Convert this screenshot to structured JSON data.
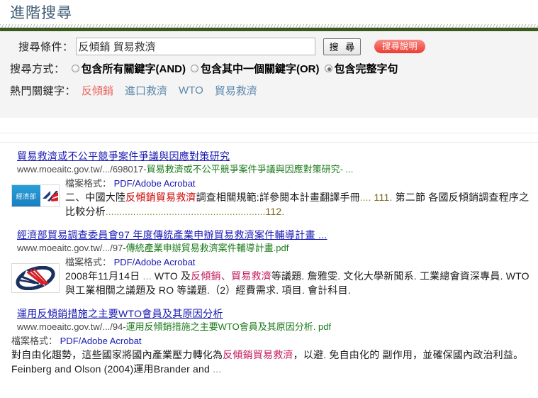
{
  "header": {
    "title": "進階搜尋",
    "accent_green": "#3a5a1e",
    "title_color": "#3d5a73"
  },
  "search": {
    "condition_label": "搜尋條件：",
    "input_value": "反傾銷 貿易救濟",
    "input_placeholder": "",
    "submit_label": "搜 尋",
    "help_label": "搜尋說明",
    "help_color": "#ed3b32",
    "mode_label": "搜尋方式：",
    "modes": [
      {
        "label": "包含所有關鍵字(AND)",
        "checked": false
      },
      {
        "label": "包含其中一個關鍵字(OR)",
        "checked": false
      },
      {
        "label": "包含完整字句",
        "checked": true
      }
    ],
    "hot_label": "熱門關鍵字：",
    "hot_keywords": [
      {
        "text": "反傾銷",
        "color": "#e8635c"
      },
      {
        "text": "進口救濟",
        "color": "#5b87ab"
      },
      {
        "text": "WTO",
        "color": "#5b87ab"
      },
      {
        "text": "貿易救濟",
        "color": "#5b87ab"
      }
    ]
  },
  "results": [
    {
      "title": "貿易救濟或不公平競爭案件爭議與因應對策研究",
      "url_host": "www.moeaitc.gov.tw/.../698017-",
      "url_tail": "貿易救濟或不公平競爭案件爭議與因應對策研究- ...",
      "format_label": "檔案格式：",
      "format_value": "PDF/Adobe Acrobat",
      "thumbnail": "moea-logo",
      "snippet_parts": [
        {
          "t": "二、中國大陸",
          "s": "plain"
        },
        {
          "t": "反傾銷貿易救濟",
          "s": "hl-red"
        },
        {
          "t": "調查相關規範:詳參閱本計畫翻譯手冊",
          "s": "plain"
        },
        {
          "t": "....",
          "s": "dots"
        },
        {
          "t": " 111.",
          "s": "pg"
        },
        {
          "t": " 第二節 各國反傾銷調查程序之比較分析",
          "s": "plain"
        },
        {
          "t": "..........................................................",
          "s": "dots"
        },
        {
          "t": "112.",
          "s": "pg"
        }
      ]
    },
    {
      "title": "經濟部貿易調查委員會97 年度傳統產業申辦貿易救濟案件輔導計畫 ...",
      "url_host": "www.moeaitc.gov.tw/.../97-",
      "url_tail": "傳統產業申辦貿易救濟案件輔導計畫.pdf",
      "format_label": "檔案格式：",
      "format_value": "PDF/Adobe Acrobat",
      "thumbnail": "globe-logo",
      "snippet_parts": [
        {
          "t": "2008年11月14日 ",
          "s": "plain"
        },
        {
          "t": "...",
          "s": "ell"
        },
        {
          "t": " WTO 及",
          "s": "plain"
        },
        {
          "t": "反傾銷、貿易救濟",
          "s": "hl"
        },
        {
          "t": "等議題. 詹雅雯. 文化大學新聞系. 工業總會資深專員. WTO 與工業相關之議題及 RO 等議題.（2）經費需求. 項目. 會計科目.",
          "s": "plain"
        }
      ]
    },
    {
      "title": "運用反傾銷措施之主要WTO會員及其原因分析",
      "url_host": "www.moeaitc.gov.tw/.../94-",
      "url_tail": "運用反傾銷措施之主要WTO會員及其原因分析. pdf",
      "format_label": "檔案格式：",
      "format_value": "PDF/Adobe Acrobat",
      "thumbnail": "none",
      "snippet_parts": [
        {
          "t": "對自由化趨勢，這些國家將國內產業壓力轉化為",
          "s": "plain"
        },
        {
          "t": "反傾銷貿易救濟",
          "s": "hl"
        },
        {
          "t": "，以避. 免自由化的 副作用，並確保國內政治利益。 Feinberg and Olson (2004)運用Brander and ",
          "s": "plain"
        },
        {
          "t": "...",
          "s": "ell"
        }
      ]
    }
  ]
}
